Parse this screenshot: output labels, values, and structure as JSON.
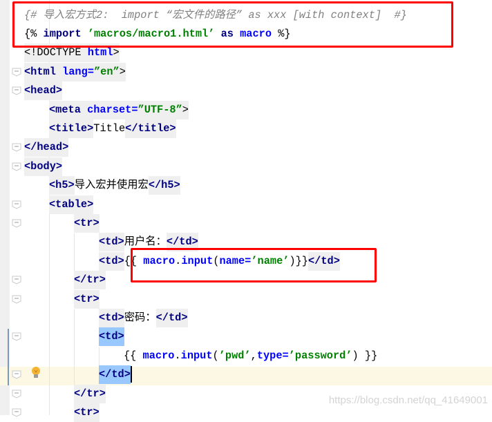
{
  "editor": {
    "lines": [
      {
        "indent": 0,
        "tokens": [
          [
            "{# 导入宏方式2:  import “宏文件的路径” as xxx [with context]  #}",
            "c",
            ""
          ]
        ]
      },
      {
        "indent": 0,
        "tokens": [
          [
            "{% ",
            "p",
            ""
          ],
          [
            "import ",
            "t",
            ""
          ],
          [
            "’macros/macro1.html’",
            "s",
            ""
          ],
          [
            " as ",
            "t",
            ""
          ],
          [
            "macro",
            "v",
            ""
          ],
          [
            " %}",
            "p",
            ""
          ]
        ]
      },
      {
        "indent": 0,
        "tokens": [
          [
            "<!DOCTYPE ",
            "p",
            "g"
          ],
          [
            "html",
            "v",
            "g"
          ],
          [
            ">",
            "p",
            "g"
          ]
        ]
      },
      {
        "indent": 0,
        "tokens": [
          [
            "<html ",
            "t",
            "g"
          ],
          [
            "lang=",
            "a",
            "g"
          ],
          [
            "”en”",
            "s",
            "g"
          ],
          [
            ">",
            "p",
            "g"
          ]
        ]
      },
      {
        "indent": 0,
        "tokens": [
          [
            "<head>",
            "t",
            "g"
          ]
        ]
      },
      {
        "indent": 1,
        "tokens": [
          [
            "<meta ",
            "t",
            "g"
          ],
          [
            "charset=",
            "a",
            "g"
          ],
          [
            "”UTF-8”",
            "s",
            "g"
          ],
          [
            ">",
            "p",
            "g"
          ]
        ]
      },
      {
        "indent": 1,
        "tokens": [
          [
            "<title>",
            "t",
            "g"
          ],
          [
            "Title",
            "p",
            ""
          ],
          [
            "</title>",
            "t",
            "g"
          ]
        ]
      },
      {
        "indent": 0,
        "tokens": [
          [
            "</head>",
            "t",
            "g"
          ]
        ]
      },
      {
        "indent": 0,
        "tokens": [
          [
            "<body>",
            "t",
            "g"
          ]
        ]
      },
      {
        "indent": 1,
        "tokens": [
          [
            "<h5>",
            "t",
            "g"
          ],
          [
            "导入宏并使用宏",
            "p",
            ""
          ],
          [
            "</h5>",
            "t",
            "g"
          ]
        ]
      },
      {
        "indent": 1,
        "tokens": [
          [
            "<table>",
            "t",
            "g"
          ]
        ]
      },
      {
        "indent": 2,
        "tokens": [
          [
            "<tr>",
            "t",
            "g"
          ]
        ]
      },
      {
        "indent": 3,
        "tokens": [
          [
            "<td>",
            "t",
            "g"
          ],
          [
            "用户名：",
            "p",
            ""
          ],
          [
            "</td>",
            "t",
            "g"
          ]
        ]
      },
      {
        "indent": 3,
        "tokens": [
          [
            "<td>",
            "t",
            "g"
          ],
          [
            "{{ ",
            "p",
            ""
          ],
          [
            "macro",
            "v",
            ""
          ],
          [
            ".",
            "p",
            ""
          ],
          [
            "input",
            "v",
            ""
          ],
          [
            "(",
            "p",
            ""
          ],
          [
            "name=",
            "v",
            ""
          ],
          [
            "’name’",
            "s",
            ""
          ],
          [
            ")}}",
            "p",
            ""
          ],
          [
            "</td>",
            "t",
            "g"
          ]
        ]
      },
      {
        "indent": 2,
        "tokens": [
          [
            "</tr>",
            "t",
            "g"
          ]
        ]
      },
      {
        "indent": 2,
        "tokens": [
          [
            "<tr>",
            "t",
            "g"
          ]
        ]
      },
      {
        "indent": 3,
        "tokens": [
          [
            "<td>",
            "t",
            "g"
          ],
          [
            "密码：",
            "p",
            ""
          ],
          [
            "</td>",
            "t",
            "g"
          ]
        ]
      },
      {
        "indent": 3,
        "tokens": [
          [
            "<td>",
            "t",
            "h"
          ]
        ]
      },
      {
        "indent": 4,
        "tokens": [
          [
            "{{ ",
            "p",
            ""
          ],
          [
            "macro",
            "v",
            ""
          ],
          [
            ".",
            "p",
            ""
          ],
          [
            "input",
            "v",
            ""
          ],
          [
            "(",
            "p",
            ""
          ],
          [
            "’pwd’",
            "s",
            ""
          ],
          [
            ",",
            "p",
            ""
          ],
          [
            "type=",
            "v",
            ""
          ],
          [
            "’password’",
            "s",
            ""
          ],
          [
            ") }}",
            "p",
            ""
          ]
        ]
      },
      {
        "indent": 3,
        "tokens": [
          [
            "</td>",
            "t",
            "h"
          ]
        ],
        "current": true
      },
      {
        "indent": 2,
        "tokens": [
          [
            "</tr>",
            "t",
            "g"
          ]
        ]
      },
      {
        "indent": 2,
        "tokens": [
          [
            "<tr>",
            "t",
            "g"
          ]
        ]
      }
    ],
    "fold_lines": [
      4,
      5,
      8,
      9,
      11,
      12,
      15,
      16,
      18,
      20,
      21,
      22
    ],
    "current_line": 20
  },
  "icons": {
    "bulb": "lightbulb-icon",
    "fold": "fold-marker-icon"
  },
  "colors": {
    "tag": "#000080",
    "attr": "#0000ff",
    "string": "#008000",
    "comment": "#808080",
    "annotation": "#ff0000",
    "selection": "#99c8ff",
    "current_line": "#fdf8e3"
  },
  "watermark": "https://blog.csdn.net/qq_41649001"
}
